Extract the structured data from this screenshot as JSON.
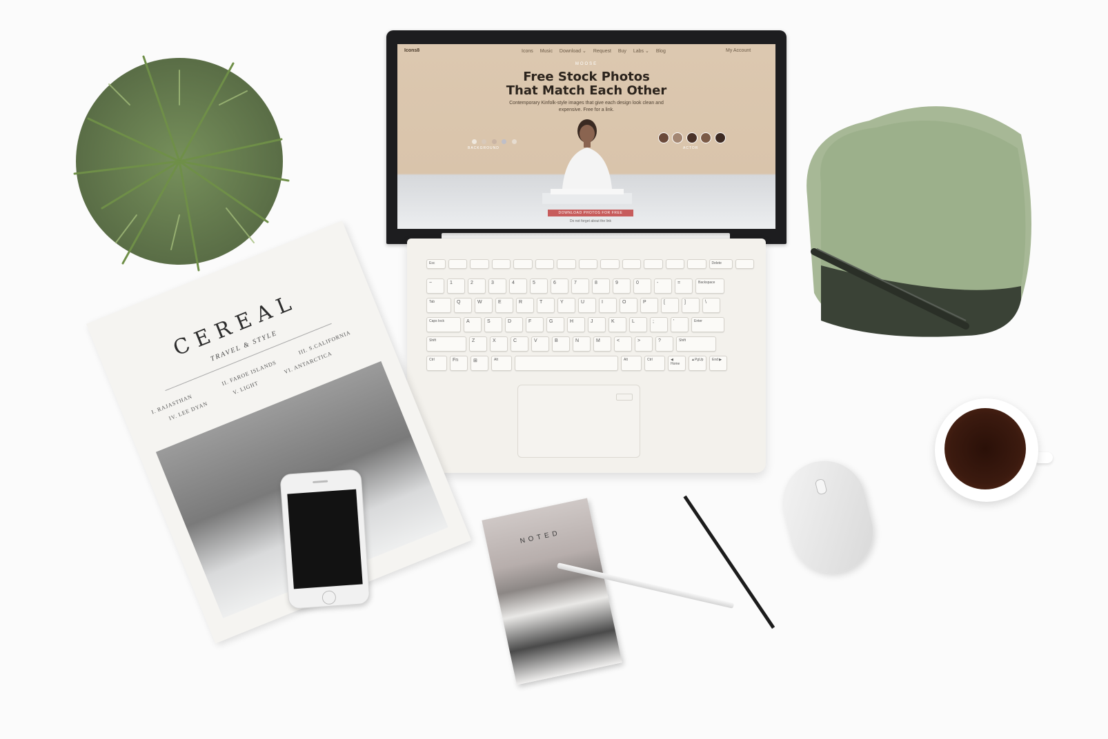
{
  "scene": {
    "description_free": true,
    "colors": {
      "background": "#fbfbfb",
      "screen_bg": "#dcc8b0",
      "cta": "#c75c5c",
      "box_green": "#9bb089",
      "plant": "#4f6b34"
    }
  },
  "laptop_screen": {
    "logo": "Icons8",
    "nav": [
      "Icons",
      "Music",
      "Download ⌄",
      "Request",
      "Buy",
      "Labs ⌄",
      "Blog"
    ],
    "account": "My Account",
    "eyebrow": "MOOSE",
    "title_line1": "Free Stock Photos",
    "title_line2": "That Match Each Other",
    "subtitle": "Contemporary Kinfolk-style images that give each design look clean and expensive. Free for a link.",
    "label_background": "BACKGROUND",
    "label_actor": "ACTOR",
    "cta": "DOWNLOAD PHOTOS FOR FREE",
    "cta_note": "Do not forget about the link"
  },
  "keyboard": {
    "row1": [
      "Esc",
      "",
      "",
      "",
      "",
      "",
      "",
      "",
      "",
      "",
      "",
      "",
      "",
      "Delete",
      ""
    ],
    "row2": [
      "~",
      "1",
      "2",
      "3",
      "4",
      "5",
      "6",
      "7",
      "8",
      "9",
      "0",
      "-",
      "=",
      "Backspace"
    ],
    "row3": [
      "Tab",
      "Q",
      "W",
      "E",
      "R",
      "T",
      "Y",
      "U",
      "I",
      "O",
      "P",
      "[",
      "]",
      "\\"
    ],
    "row4": [
      "Caps lock",
      "A",
      "S",
      "D",
      "F",
      "G",
      "H",
      "J",
      "K",
      "L",
      ";",
      "'",
      "Enter"
    ],
    "row5": [
      "Shift",
      "Z",
      "X",
      "C",
      "V",
      "B",
      "N",
      "M",
      "<",
      ">",
      "?",
      "Shift"
    ],
    "row6": [
      "Ctrl",
      "Fn",
      "⊞",
      "Alt",
      "",
      "Alt",
      "Ctrl",
      "◀ Home",
      "▲PgUp",
      "End ▶"
    ]
  },
  "magazine": {
    "title": "CEREAL",
    "subtitle": "TRAVEL & STYLE",
    "toc": [
      "I. RAJASTHAN",
      "II. FAROE ISLANDS",
      "III. S.CALIFORNIA",
      "IV. LEE DYAN",
      "V. LIGHT",
      "VI. ANTARCTICA"
    ]
  },
  "notebook": {
    "title": "NOTED"
  }
}
